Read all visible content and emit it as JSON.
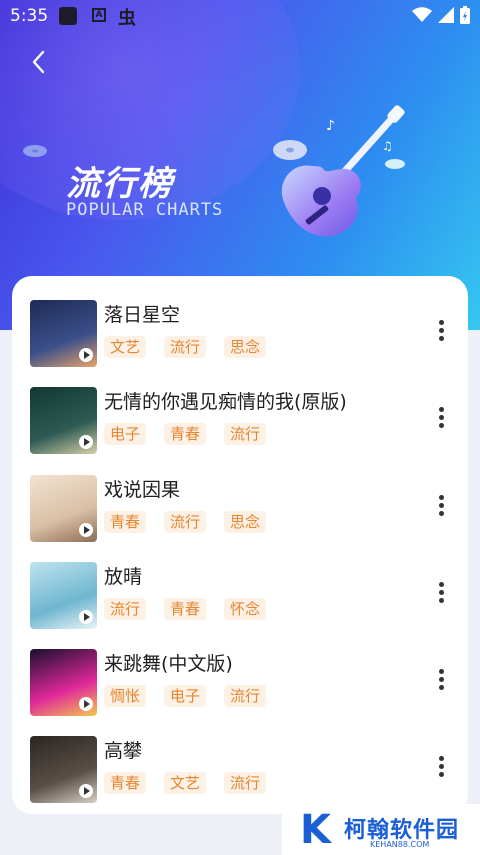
{
  "status_bar": {
    "time": "5:35"
  },
  "header": {
    "title_cn": "流行榜",
    "title_en": "POPULAR CHARTS"
  },
  "songs": [
    {
      "title": "落日星空",
      "tags": [
        "文艺",
        "流行",
        "思念"
      ],
      "cover_colors": [
        "#1d2a55",
        "#3b4f8a",
        "#e7a36a"
      ]
    },
    {
      "title": "无情的你遇见痴情的我(原版)",
      "tags": [
        "电子",
        "青春",
        "流行"
      ],
      "cover_colors": [
        "#123832",
        "#2d5a52",
        "#d7d1a9"
      ]
    },
    {
      "title": "戏说因果",
      "tags": [
        "青春",
        "流行",
        "思念"
      ],
      "cover_colors": [
        "#f3e3d1",
        "#d9bfa5",
        "#8d6d55"
      ]
    },
    {
      "title": "放晴",
      "tags": [
        "流行",
        "青春",
        "怀念"
      ],
      "cover_colors": [
        "#bfe3ee",
        "#6fb6cf",
        "#e9f4f7"
      ]
    },
    {
      "title": "来跳舞(中文版)",
      "tags": [
        "惆怅",
        "电子",
        "流行"
      ],
      "cover_colors": [
        "#1a0f2e",
        "#e0289a",
        "#f2c94c"
      ]
    },
    {
      "title": "高攀",
      "tags": [
        "青春",
        "文艺",
        "流行"
      ],
      "cover_colors": [
        "#2a2522",
        "#5a4f47",
        "#d7cfc6"
      ]
    }
  ],
  "watermark": {
    "logo_text": "柯翰软件园",
    "domain": "KEHAN88.COM"
  },
  "colors": {
    "accent": "#e7852e",
    "tag_bg": "#fdf1e6",
    "hero_start": "#3a2fd6",
    "hero_end": "#35c7f0"
  }
}
